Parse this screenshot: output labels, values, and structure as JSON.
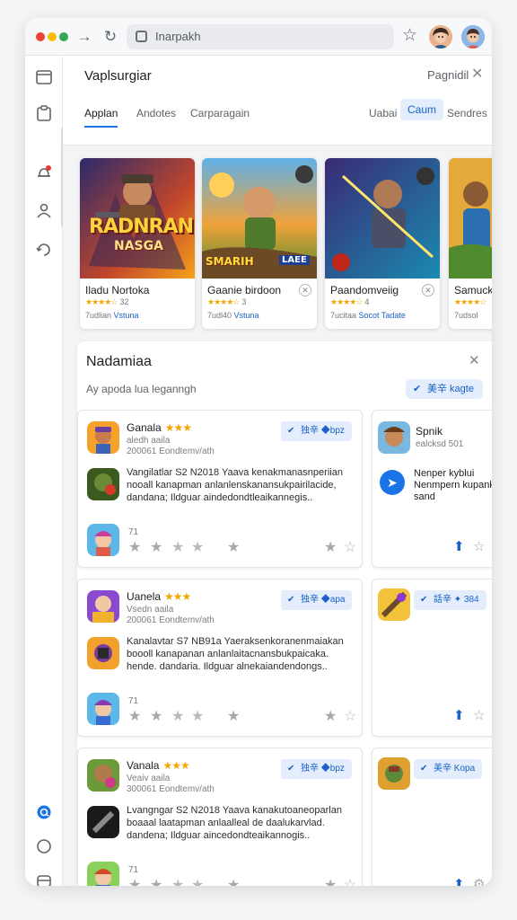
{
  "browser": {
    "address": "Inarpakh"
  },
  "panel": {
    "title": "Vaplsurgiar",
    "right_label": "Pagnidil",
    "tabs": [
      {
        "label": "Applan",
        "active": true
      },
      {
        "label": "Andotes",
        "active": false
      },
      {
        "label": "Carparagain",
        "active": false
      },
      {
        "label": "Uabai",
        "active": false
      },
      {
        "label": "Caum",
        "active": false,
        "highlight": true
      },
      {
        "label": "Sendres",
        "active": false
      }
    ]
  },
  "featured": [
    {
      "name": "Iladu Nortoka",
      "art_title": "RADNRAN",
      "art_sub": "NASGA",
      "stars": "★★★★☆",
      "rating": "32",
      "sub_left": "7udlian",
      "sub_link": "Vstuna"
    },
    {
      "name": "Gaanie birdoon",
      "art_title": "SMARIH",
      "art_sub": "LAEE",
      "stars": "★★★★☆",
      "rating": "3",
      "sub_left": "7udl40",
      "sub_link": "Vstuna"
    },
    {
      "name": "Paandomveiig",
      "stars": "★★★★☆",
      "rating": "4",
      "sub_left": "7ucitaa",
      "sub_link": "Socot Tadate"
    },
    {
      "name": "Samuck",
      "stars": "★★★★☆",
      "rating": "",
      "sub_left": "7udsol",
      "sub_link": ""
    }
  ],
  "section": {
    "title": "Nadamiaa",
    "subtitle": "Ay apoda lua leganngh",
    "button": "美辛 kagte"
  },
  "cards": [
    {
      "name": "Ganala",
      "stars": "★★★",
      "sub1": "aledh aaila",
      "sub2": "200061 Eondtemv/ath",
      "tag": "独辛 ◆bpz",
      "desc": "Vangilatlar S2 N2018 Yaava kenakmanasnperiian nooall kanapman anlanlenskanansukpairilacide, dandana; Ildguar aindedondtleaikannegis..",
      "num": "71",
      "side": {
        "name": "Spnik",
        "sub": "ealcksd 501",
        "desc": "Nenper kyblui Nenmpern kupank sand"
      }
    },
    {
      "name": "Uanela",
      "stars": "★★★",
      "sub1": "Vsedn aaila",
      "sub2": "200061 Eondtemv/ath",
      "tag": "独辛 ◆apa",
      "desc": "Kanalavtar S7 NB91a Yaeraksenkoranenmaiakan boooll kanapanan anlanlaitacnansbukpaicaka. hende. dandaria. Ildguar alnekaiandendongs..",
      "num": "71",
      "side": {
        "tag": "話辛 ✦ 384"
      }
    },
    {
      "name": "Vanala",
      "stars": "★★★",
      "sub1": "Veaiv aaila",
      "sub2": "300061 Eondtemv/ath",
      "tag": "独辛 ◆bpz",
      "desc": "Lvangngar S2 N2018 Yaava kanakutoaneoparlan boaaal laatapman anlaalleal de daalukarvlad. dandena; Ildguar aincedondteaikannogis..",
      "num": "71",
      "side": {
        "tag": "美辛 Kopa"
      }
    }
  ],
  "colors": {
    "accent": "#1a73e8",
    "pill_bg": "#e3edfb",
    "star": "#f2a600"
  }
}
